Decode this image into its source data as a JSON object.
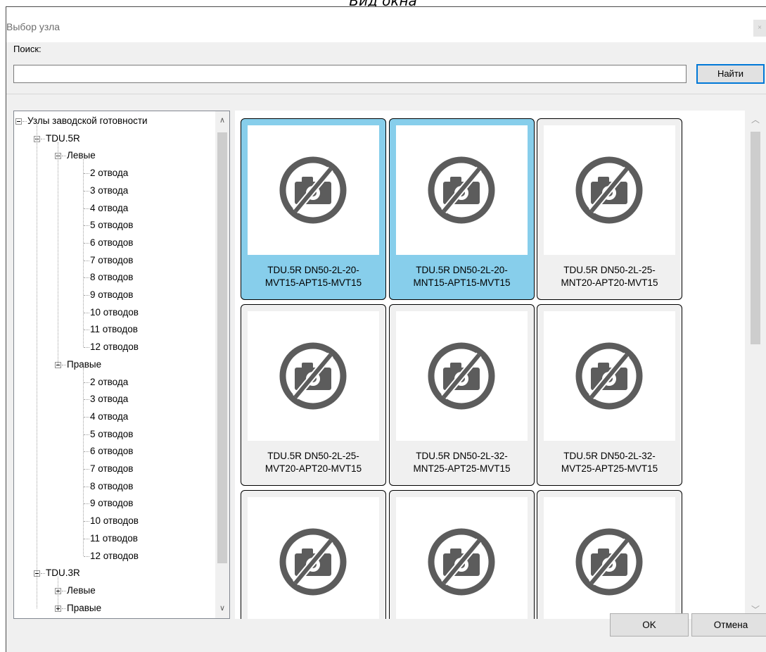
{
  "caption": "Вид окна",
  "window": {
    "title": "Выбор узла",
    "close_glyph": "×"
  },
  "search": {
    "label": "Поиск:",
    "value": "",
    "placeholder": "",
    "button_label": "Найти"
  },
  "tree": {
    "rows": [
      {
        "label": "Узлы заводской готовности",
        "level": 0,
        "expander": "minus"
      },
      {
        "label": "TDU.5R",
        "level": 1,
        "expander": "minus"
      },
      {
        "label": "Левые",
        "level": 2,
        "expander": "minus"
      },
      {
        "label": "2 отвода",
        "level": 3
      },
      {
        "label": "3 отвода",
        "level": 3
      },
      {
        "label": "4 отвода",
        "level": 3
      },
      {
        "label": "5 отводов",
        "level": 3
      },
      {
        "label": "6 отводов",
        "level": 3
      },
      {
        "label": "7 отводов",
        "level": 3
      },
      {
        "label": "8 отводов",
        "level": 3
      },
      {
        "label": "9 отводов",
        "level": 3
      },
      {
        "label": "10 отводов",
        "level": 3
      },
      {
        "label": "11 отводов",
        "level": 3
      },
      {
        "label": "12 отводов",
        "level": 3
      },
      {
        "label": "Правые",
        "level": 2,
        "expander": "minus"
      },
      {
        "label": "2 отвода",
        "level": 3
      },
      {
        "label": "3 отвода",
        "level": 3
      },
      {
        "label": "4 отвода",
        "level": 3
      },
      {
        "label": "5 отводов",
        "level": 3
      },
      {
        "label": "6 отводов",
        "level": 3
      },
      {
        "label": "7 отводов",
        "level": 3
      },
      {
        "label": "8 отводов",
        "level": 3
      },
      {
        "label": "9 отводов",
        "level": 3
      },
      {
        "label": "10 отводов",
        "level": 3
      },
      {
        "label": "11 отводов",
        "level": 3
      },
      {
        "label": "12 отводов",
        "level": 3
      },
      {
        "label": "TDU.3R",
        "level": 1,
        "expander": "minus"
      },
      {
        "label": "Левые",
        "level": 2,
        "expander": "plus"
      },
      {
        "label": "Правые",
        "level": 2,
        "expander": "plus"
      }
    ]
  },
  "tiles": [
    {
      "line1": "TDU.5R DN50-2L-20-",
      "line2": "MVT15-APT15-MVT15",
      "selected": true,
      "icon": "no-photo-icon"
    },
    {
      "line1": "TDU.5R DN50-2L-20-",
      "line2": "MNT15-APT15-MVT15",
      "selected": true,
      "icon": "no-photo-icon"
    },
    {
      "line1": "TDU.5R DN50-2L-25-",
      "line2": "MNT20-APT20-MVT15",
      "selected": false,
      "icon": "no-photo-icon"
    },
    {
      "line1": "TDU.5R DN50-2L-25-",
      "line2": "MVT20-APT20-MVT15",
      "selected": false,
      "icon": "no-photo-icon"
    },
    {
      "line1": "TDU.5R DN50-2L-32-",
      "line2": "MNT25-APT25-MVT15",
      "selected": false,
      "icon": "no-photo-icon"
    },
    {
      "line1": "TDU.5R DN50-2L-32-",
      "line2": "MVT25-APT25-MVT15",
      "selected": false,
      "icon": "no-photo-icon"
    },
    {
      "line1": "",
      "line2": "",
      "selected": false,
      "icon": "no-photo-icon"
    },
    {
      "line1": "",
      "line2": "",
      "selected": false,
      "icon": "no-photo-icon"
    },
    {
      "line1": "",
      "line2": "",
      "selected": false,
      "icon": "no-photo-icon"
    }
  ],
  "buttons": {
    "ok": "OK",
    "cancel": "Отмена"
  },
  "colors": {
    "selected_tile": "#87ceeb",
    "accent": "#0078d7",
    "dialog_bg": "#f0f0f0"
  }
}
